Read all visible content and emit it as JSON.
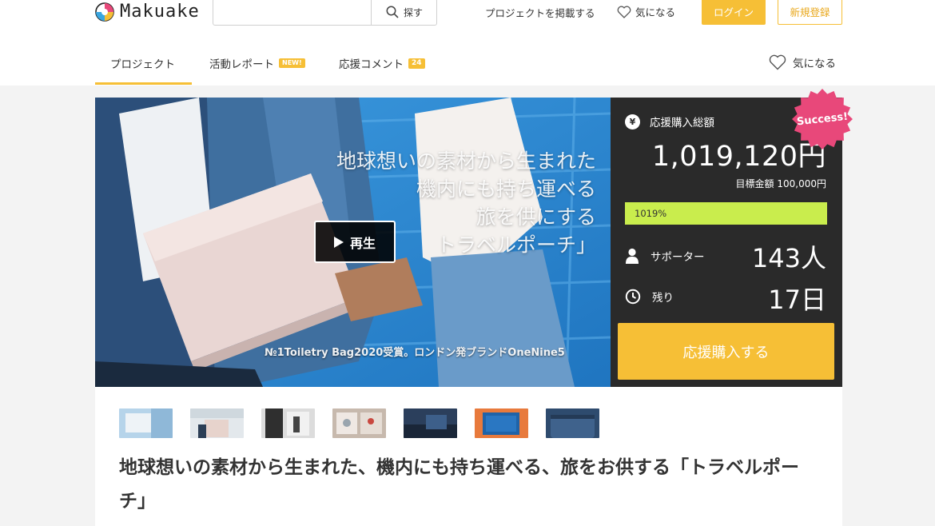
{
  "header": {
    "logo_text": "Makuake",
    "search": {
      "placeholder": "",
      "button_label": "探す"
    },
    "post_project_label": "プロジェクトを掲載する",
    "favorite_label": "気になる",
    "login_label": "ログイン",
    "signup_label": "新規登録"
  },
  "tabs": [
    {
      "label": "プロジェクト",
      "active": true
    },
    {
      "label": "活動レポート",
      "badge": "NEW!"
    },
    {
      "label": "応援コメント",
      "badge": "24"
    }
  ],
  "favorite_tab_label": "気になる",
  "hero": {
    "copy_lines": [
      "地球想いの素材から生まれた",
      "機内にも持ち運べる",
      "旅を供にする",
      "トラベルポーチ」"
    ],
    "caption": "№1Toiletry Bag2020受賞。ロンドン発ブランドOneNine5",
    "play_label": "再生"
  },
  "stats": {
    "total_label": "応援購入総額",
    "yen_symbol": "¥",
    "total_amount": "1,019,120円",
    "target": "目標金額 100,000円",
    "progress_text": "1019%",
    "progress_fill": 1.0,
    "supporters_label": "サポーター",
    "supporters_value": "143人",
    "remaining_label": "残り",
    "remaining_value": "17日",
    "cta_label": "応援購入する",
    "success_badge": "Success!"
  },
  "thumbnails": [
    {
      "icon": "thumbnail-1"
    },
    {
      "icon": "thumbnail-2"
    },
    {
      "icon": "thumbnail-3"
    },
    {
      "icon": "thumbnail-4"
    },
    {
      "icon": "thumbnail-5"
    },
    {
      "icon": "thumbnail-6"
    },
    {
      "icon": "thumbnail-7"
    }
  ],
  "project_title": "地球想いの素材から生まれた、機内にも持ち運べる、旅をお供する「トラベルポーチ」",
  "colors": {
    "accent": "#f6bf36",
    "panel_bg": "#2a2a2a",
    "progress": "#c9ed4d",
    "success": "#e8487a"
  }
}
